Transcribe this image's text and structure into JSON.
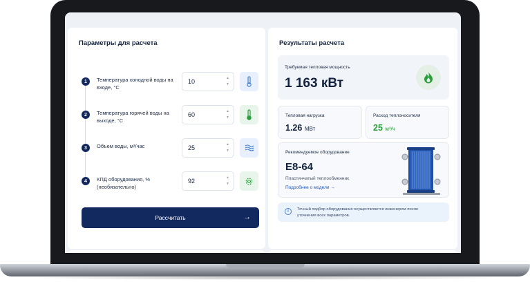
{
  "params": {
    "title": "Параметры для расчета",
    "rows": [
      {
        "num": "1",
        "label": "Температура холодной воды на входе, °С",
        "value": "10",
        "icon": "thermometer-icon"
      },
      {
        "num": "2",
        "label": "Температура горячей воды на выходе, °С",
        "value": "60",
        "icon": "thermometer-icon"
      },
      {
        "num": "3",
        "label": "Объем воды, м³/час",
        "value": "25",
        "icon": "waves-icon"
      },
      {
        "num": "4",
        "label": "КПД оборудования, % (необязательно)",
        "value": "92",
        "icon": "gear-icon"
      }
    ],
    "button": "Рассчитать"
  },
  "results": {
    "title": "Результаты расчета",
    "power_label": "Требуемая тепловая мощность",
    "power_value": "1 163 кВт",
    "load_label": "Тепловая нагрузка",
    "load_value": "1.26",
    "load_unit": "МВт",
    "flow_label": "Расход теплоносителя",
    "flow_value": "25",
    "flow_unit": "м³/ч",
    "equip_label": "Рекомендуемое оборудование",
    "equip_model": "E8-64",
    "equip_desc": "Пластинчатый теплообменник",
    "equip_link": "Подробнее о модели →",
    "note": "Точный подбор оборудования осуществляется инженером после уточнения всех параметров."
  },
  "colors": {
    "primary": "#12295f",
    "accent_green": "#2a9d3c",
    "link_blue": "#1e52b8",
    "frame": "#17191d"
  }
}
